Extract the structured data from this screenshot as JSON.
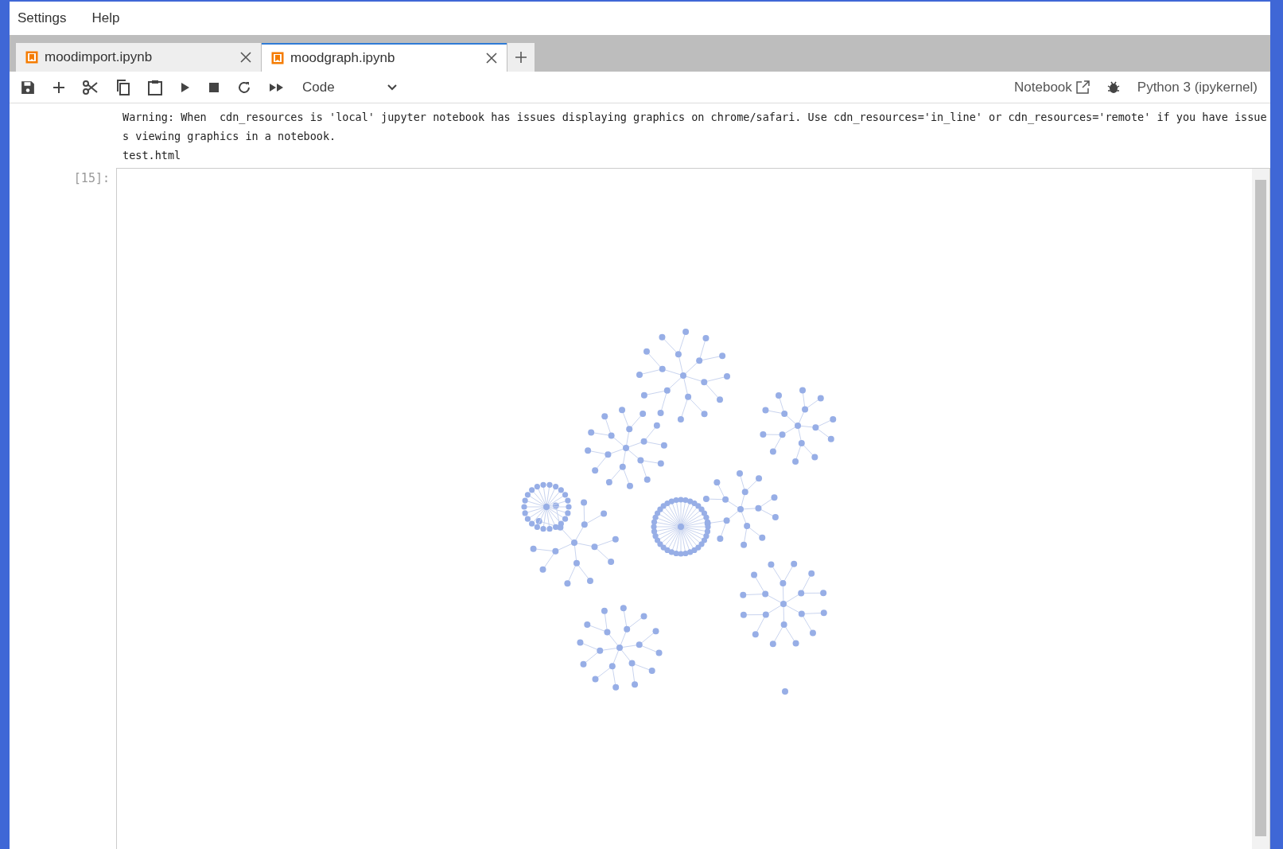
{
  "menu": [
    "Settings",
    "Help"
  ],
  "tabs": [
    {
      "label": "moodimport.ipynb",
      "selected": false
    },
    {
      "label": "moodgraph.ipynb",
      "selected": true
    }
  ],
  "toolbar": {
    "cell_type": "Code",
    "open_with": "Notebook",
    "kernel": "Python 3 (ipykernel)"
  },
  "output": {
    "warning": "Warning: When  cdn_resources is 'local' jupyter notebook has issues displaying graphics on chrome/safari. Use cdn_resources='in_line' or cdn_resources='remote' if you have issues viewing graphics in a notebook.",
    "file": "test.html"
  },
  "cell": {
    "prompt": "[15]:"
  }
}
